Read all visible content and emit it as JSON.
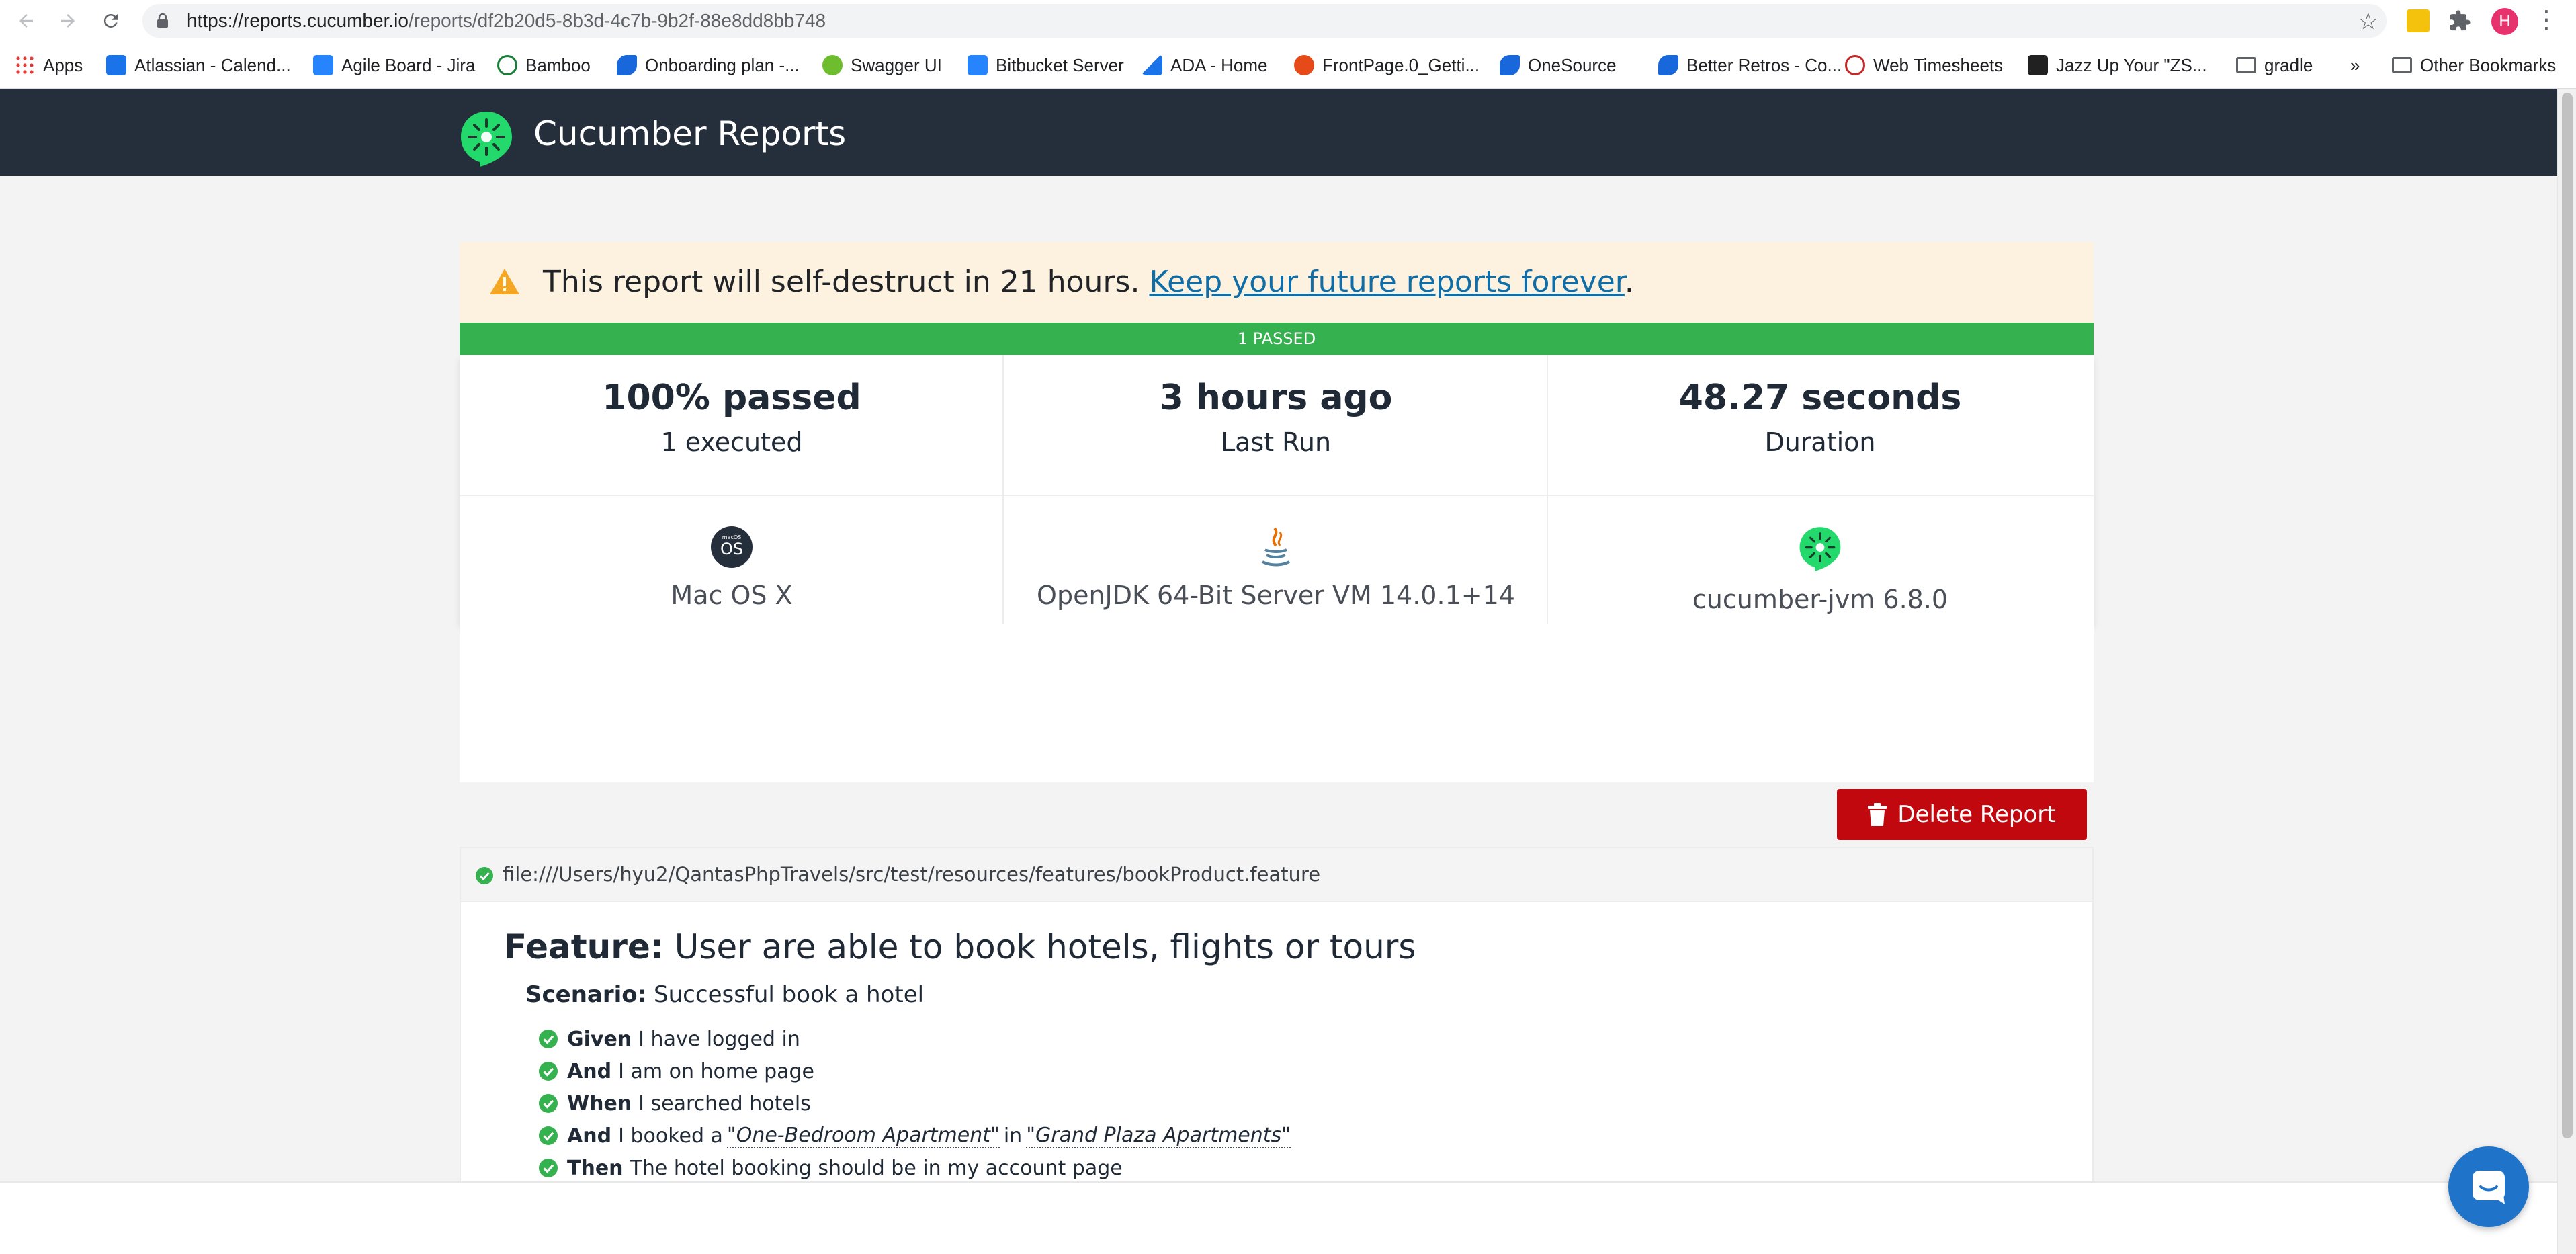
{
  "browser": {
    "url_host": "https://reports.cucumber.io",
    "url_path": "/reports/df2b20d5-8b3d-4c7b-9b2f-88e8dd8bb748",
    "profile_initial": "H",
    "bookmarks": [
      {
        "label": "Apps",
        "icon": "apps-grid-icon",
        "color": "#e53935"
      },
      {
        "label": "Atlassian - Calend...",
        "icon": "calendar-icon",
        "color": "#1a73e8"
      },
      {
        "label": "Agile Board - Jira",
        "icon": "jira-icon",
        "color": "#2684ff"
      },
      {
        "label": "Bamboo",
        "icon": "bamboo-icon",
        "color": "#188038"
      },
      {
        "label": "Onboarding plan -...",
        "icon": "confluence-icon",
        "color": "#1868db"
      },
      {
        "label": "Swagger UI",
        "icon": "swagger-icon",
        "color": "#6dbd2f"
      },
      {
        "label": "Bitbucket Server",
        "icon": "bitbucket-icon",
        "color": "#2684ff"
      },
      {
        "label": "ADA - Home",
        "icon": "ada-icon",
        "color": "#1a73e8"
      },
      {
        "label": "FrontPage.0_Getti...",
        "icon": "frontpage-icon",
        "color": "#e64a19"
      },
      {
        "label": "OneSource",
        "icon": "confluence-icon",
        "color": "#1868db"
      },
      {
        "label": "Better Retros - Co...",
        "icon": "confluence-icon",
        "color": "#1868db"
      },
      {
        "label": "Web Timesheets",
        "icon": "timesheet-icon",
        "color": "#c62828"
      },
      {
        "label": "Jazz Up Your \"ZS...",
        "icon": "jazz-icon",
        "color": "#212121"
      },
      {
        "label": "gradle",
        "icon": "folder-icon",
        "color": "#5f6368"
      }
    ],
    "overflow": "»",
    "other_bookmarks": "Other Bookmarks"
  },
  "header": {
    "brand": "Cucumber Reports"
  },
  "banner": {
    "text": "This report will self-destruct in 21 hours. ",
    "link": "Keep your future reports forever",
    "suffix": "."
  },
  "summary": {
    "status_bar": "1 PASSED",
    "passed_pct": "100% passed",
    "executed": "1 executed",
    "last_run": "3 hours ago",
    "last_run_label": "Last Run",
    "duration": "48.27 seconds",
    "duration_label": "Duration",
    "os_badge": "OS",
    "os_badge_small": "macOS",
    "os": "Mac OS X",
    "jvm": "OpenJDK 64-Bit Server VM 14.0.1+14",
    "tool": "cucumber-jvm 6.8.0"
  },
  "actions": {
    "delete": "Delete Report"
  },
  "feature": {
    "file": "file:///Users/hyu2/QantasPhpTravels/src/test/resources/features/bookProduct.feature",
    "keyword": "Feature:",
    "title": "User are able to book hotels, flights or tours",
    "scenario_keyword": "Scenario:",
    "scenario_title": "Successful book a hotel",
    "steps": [
      {
        "keyword": "Given",
        "pre": "I have logged in",
        "p1": "",
        "mid": "",
        "p2": ""
      },
      {
        "keyword": "And",
        "pre": "I am on home page",
        "p1": "",
        "mid": "",
        "p2": ""
      },
      {
        "keyword": "When",
        "pre": "I searched hotels",
        "p1": "",
        "mid": "",
        "p2": ""
      },
      {
        "keyword": "And",
        "pre": "I booked a",
        "p1": "\"One-Bedroom Apartment\"",
        "mid": "in",
        "p2": "\"Grand Plaza Apartments\""
      },
      {
        "keyword": "Then",
        "pre": "The hotel booking should be in my account page",
        "p1": "",
        "mid": "",
        "p2": ""
      }
    ]
  },
  "colors": {
    "navbar": "#252e3b",
    "pass_green": "#36b14f",
    "delete_red": "#c1080e",
    "banner_bg": "#fdf1df",
    "warning": "#f5a623",
    "link": "#0f6ea8",
    "chat": "#1f74c9"
  }
}
